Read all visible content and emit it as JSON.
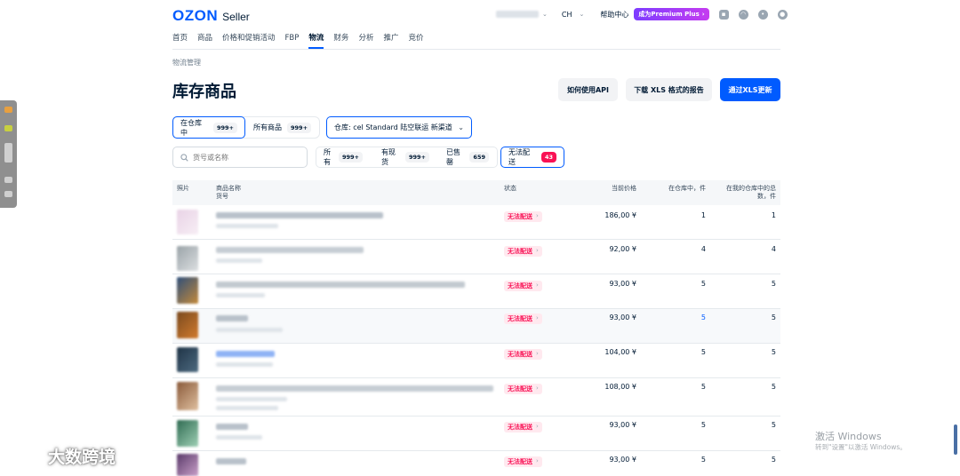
{
  "header": {
    "logo_primary": "OZON",
    "logo_secondary": "Seller",
    "language": "CH",
    "help": "帮助中心",
    "premium": "成为Premium Plus"
  },
  "nav": [
    "首页",
    "商品",
    "价格和促销活动",
    "FBP",
    "物流",
    "财务",
    "分析",
    "推广",
    "竞价"
  ],
  "nav_active": "物流",
  "breadcrumb": "物流管理",
  "page_title": "库存商品",
  "buttons": {
    "api": "如何使用API",
    "download_xls": "下载 XLS 格式的报告",
    "update_xls": "通过XLS更新"
  },
  "segment": {
    "in_stock_label": "在仓库中",
    "in_stock_count": "999+",
    "all_label": "所有商品",
    "all_count": "999+"
  },
  "warehouse_select": "仓库: cel Standard 陆空联运 新渠道",
  "search": {
    "placeholder": "货号或名称"
  },
  "status_tabs": [
    {
      "label": "所有",
      "count": "999+"
    },
    {
      "label": "有现货",
      "count": "999+"
    },
    {
      "label": "已售罄",
      "count": "659"
    },
    {
      "label": "无法配送",
      "count": "43"
    }
  ],
  "table": {
    "columns": {
      "photo": "照片",
      "name": "商品名称",
      "sku": "货号",
      "status": "状态",
      "price": "当前价格",
      "qty_in_warehouse": "在仓库中，件",
      "qty_total_1": "在我的仓库中的总",
      "qty_total_2": "数，件"
    },
    "rows": [
      {
        "status": "无法配送",
        "price": "186,00 ¥",
        "qty_in_warehouse": "1",
        "qty_total": "1"
      },
      {
        "status": "无法配送",
        "price": "92,00 ¥",
        "qty_in_warehouse": "4",
        "qty_total": "4"
      },
      {
        "status": "无法配送",
        "price": "93,00 ¥",
        "qty_in_warehouse": "5",
        "qty_total": "5"
      },
      {
        "status": "无法配送",
        "price": "93,00 ¥",
        "qty_in_warehouse": "5",
        "qty_total": "5"
      },
      {
        "status": "无法配送",
        "price": "104,00 ¥",
        "qty_in_warehouse": "5",
        "qty_total": "5"
      },
      {
        "status": "无法配送",
        "price": "108,00 ¥",
        "qty_in_warehouse": "5",
        "qty_total": "5"
      },
      {
        "status": "无法配送",
        "price": "93,00 ¥",
        "qty_in_warehouse": "5",
        "qty_total": "5"
      },
      {
        "status": "无法配送",
        "price": "93,00 ¥",
        "qty_in_warehouse": "5",
        "qty_total": "5"
      }
    ]
  },
  "watermark": {
    "brand": "大数跨境",
    "windows_title": "激活 Windows",
    "windows_sub": "转到\"设置\"以激活 Windows。"
  },
  "colors": {
    "accent": "#005bff",
    "status_red": "#f91155"
  },
  "icons": [
    "chat-icon",
    "headset-icon",
    "bell-icon",
    "user-icon",
    "search-icon",
    "chevron-down-icon"
  ]
}
